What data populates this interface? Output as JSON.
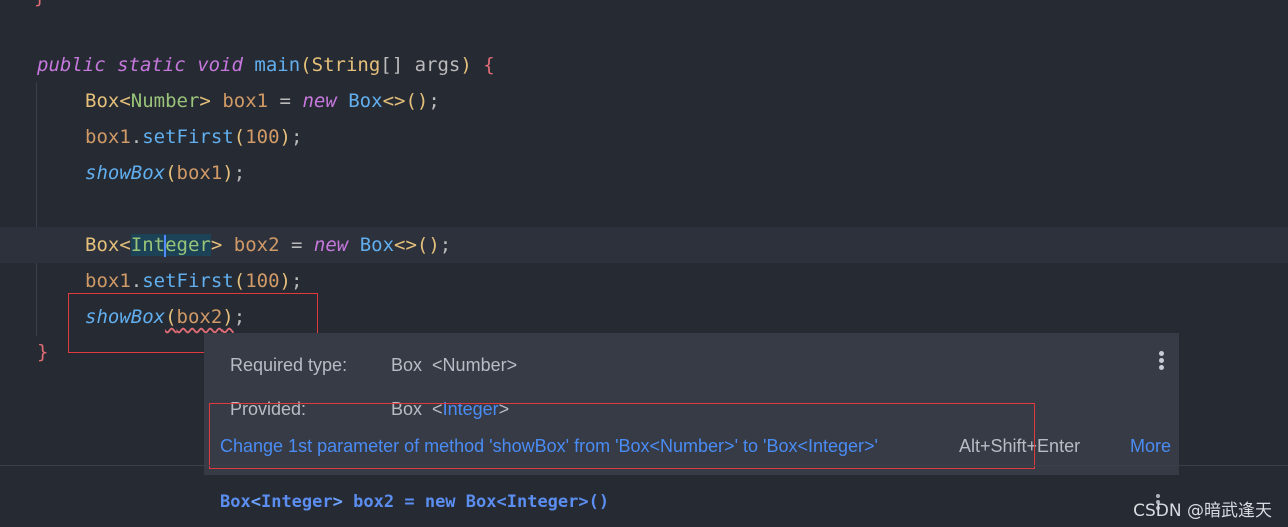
{
  "code": {
    "top_brace": "}",
    "line1": {
      "kw1": "public",
      "kw2": "static",
      "kw3": "void",
      "fn": "main",
      "p1": "(",
      "type": "String",
      "arr": "[]",
      "arg": "args",
      "p2": ")",
      "brace": "{"
    },
    "line2": {
      "type": "Box",
      "lt": "<",
      "gen": "Number",
      "gt": ">",
      "var": "box1",
      "eq": "=",
      "kw": "new",
      "ctor": "Box",
      "diamond": "<>",
      "paren": "()",
      "semi": ";"
    },
    "line3": {
      "var": "box1",
      "dot": ".",
      "fn": "setFirst",
      "p1": "(",
      "num": "100",
      "p2": ")",
      "semi": ";"
    },
    "line4": {
      "fn": "showBox",
      "p1": "(",
      "var": "box1",
      "p2": ")",
      "semi": ";"
    },
    "line6": {
      "type": "Box",
      "lt": "<",
      "gen_a": "Int",
      "gen_b": "eger",
      "gt": ">",
      "var": "box2",
      "eq": "=",
      "kw": "new",
      "ctor": "Box",
      "diamond": "<>",
      "paren": "()",
      "semi": ";"
    },
    "line7": {
      "var": "box1",
      "dot": ".",
      "fn": "setFirst",
      "p1": "(",
      "num": "100",
      "p2": ")",
      "semi": ";"
    },
    "line8": {
      "fn": "showBox",
      "p1": "(",
      "var": "box2",
      "p2": ")",
      "semi": ";"
    },
    "close_brace": "}"
  },
  "popup": {
    "required_label": "Required type:",
    "required_box": "Box",
    "required_gen": "<Number>",
    "provided_label": "Provided:",
    "provided_box": "Box",
    "provided_lt": "<",
    "provided_gen": "Integer",
    "provided_gt": ">",
    "fix_text": "Change 1st parameter of method 'showBox' from 'Box<Number>' to 'Box<Integer>'",
    "shortcut": "Alt+Shift+Enter",
    "more": "More"
  },
  "signature": {
    "a": "Box",
    "lt": "<",
    "b": "Integer",
    "gt": ">",
    "c": "box2",
    "d": "=",
    "e": "new",
    "f": "Box<Integer>()"
  },
  "watermark": "CSDN @暗武逢天",
  "colors": {
    "background": "#262a33",
    "keyword": "#c678dd",
    "function": "#61afef",
    "error": "#e06c75",
    "annotation": "#e0393e"
  }
}
